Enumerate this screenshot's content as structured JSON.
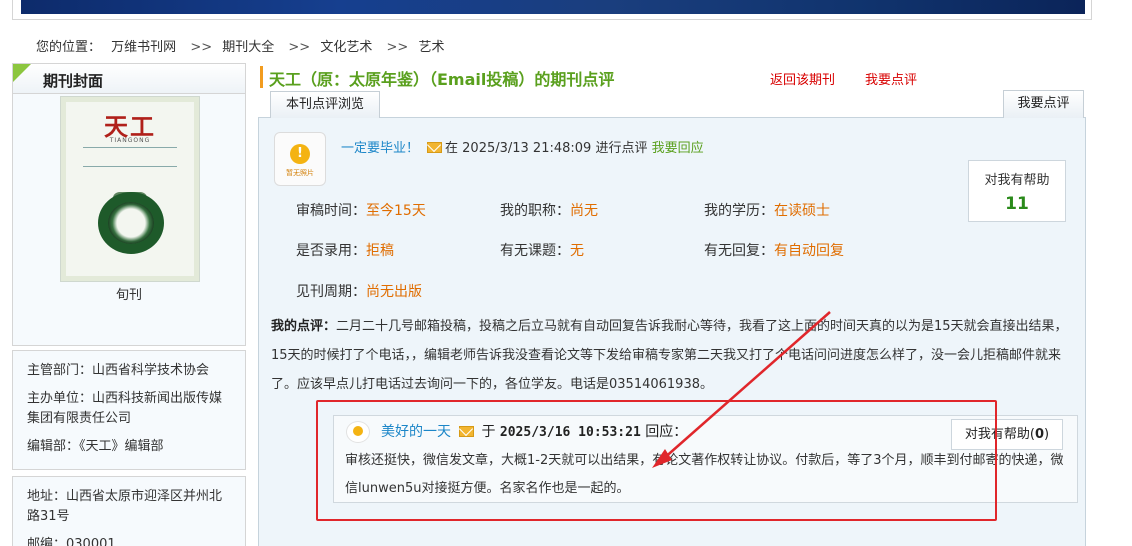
{
  "breadcrumb": {
    "label": "您的位置：",
    "items": [
      "万维书刊网",
      "期刊大全",
      "文化艺术",
      "艺术"
    ],
    "separator": ">>"
  },
  "sidebar": {
    "cover_heading": "期刊封面",
    "cover_title_text": "天工",
    "cover_subtitle_text": "TIANGONG",
    "frequency": "旬刊",
    "info": {
      "supervisor": "主管部门：山西省科学技术协会",
      "sponsor": "主办单位：山西科技新闻出版传媒集团有限责任公司",
      "editorial": "编辑部：《天工》编辑部",
      "address": "地址：山西省太原市迎泽区并州北路31号",
      "postcode": "邮编：030001"
    }
  },
  "header": {
    "title": "天工（原：太原年鉴）（Email投稿）的期刊点评",
    "back_link": "返回该期刊",
    "review_link": "我要点评"
  },
  "tabs": {
    "browse": "本刊点评浏览",
    "write": "我要点评"
  },
  "review": {
    "avatar_caption": "暂无照片",
    "user": "一定要毕业！",
    "time_text": "在 2025/3/13 21:48:09 进行点评",
    "reply_link": "我要回应",
    "help_label": "对我有帮助",
    "help_count": "11",
    "fields": {
      "review_time_label": "审稿时间：",
      "review_time_value": "至今15天",
      "title_label": "我的职称：",
      "title_value": "尚无",
      "education_label": "我的学历：",
      "education_value": "在读硕士",
      "accepted_label": "是否录用：",
      "accepted_value": "拒稿",
      "topic_label": "有无课题：",
      "topic_value": "无",
      "autoreply_label": "有无回复：",
      "autoreply_value": "有自动回复",
      "cycle_label": "见刊周期：",
      "cycle_value": "尚无出版"
    },
    "comment_label": "我的点评：",
    "comment_text": "二月二十几号邮箱投稿，投稿之后立马就有自动回复告诉我耐心等待，我看了这上面的时间天真的以为是15天就会直接出结果，15天的时候打了个电话，，编辑老师告诉我没查看论文等下发给审稿专家第二天我又打了个电话问问进度怎么样了，没一会儿拒稿邮件就来了。应该早点儿打电话过去询问一下的，各位学友。电话是03514061938。"
  },
  "reply": {
    "user": "美好的一天",
    "prefix": "于",
    "time": "2025/3/16 10:53:21",
    "suffix": "回应：",
    "text": "审核还挺快，微信发文章，大概1-2天就可以出结果，有论文著作权转让协议。付款后，等了3个月，顺丰到付邮寄的快递，微信lunwen5u对接挺方便。名家名作也是一起的。",
    "help_label": "对我有帮助(",
    "help_count": "0",
    "help_close": ")"
  },
  "colors": {
    "title_green": "#5aa01e",
    "link_red": "#d80000",
    "value_orange": "#e06d00",
    "user_blue": "#1c86c8",
    "annotation_red": "#e0262b"
  }
}
